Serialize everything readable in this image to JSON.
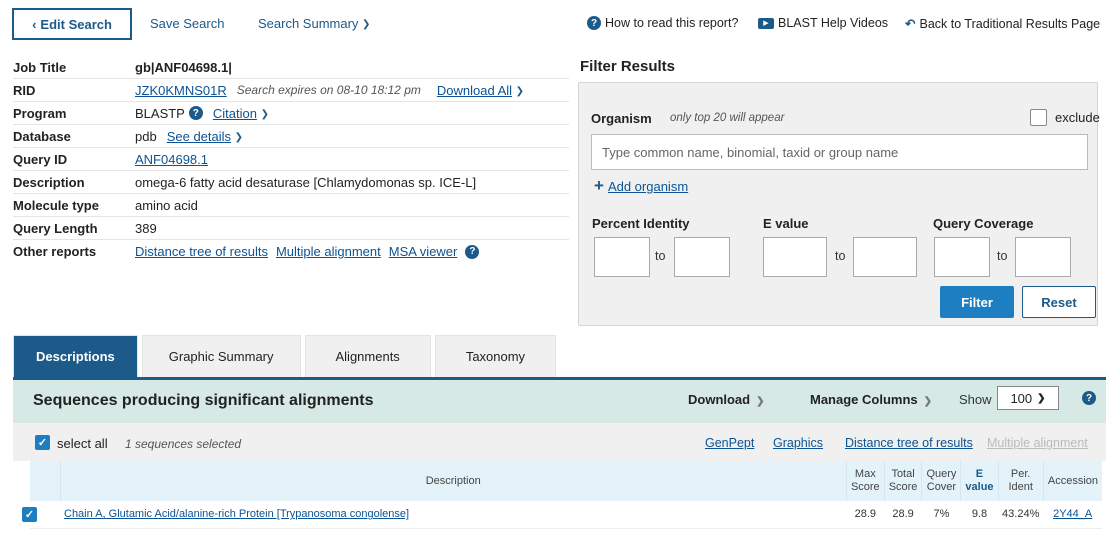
{
  "topbar": {
    "edit_search": "Edit Search",
    "save_search": "Save Search",
    "search_summary": "Search Summary",
    "how_to_read": "How to read this report?",
    "help_videos": "BLAST Help Videos",
    "back_traditional": "Back to Traditional Results Page"
  },
  "info": {
    "job_title_label": "Job Title",
    "job_title": "gb|ANF04698.1|",
    "rid_label": "RID",
    "rid": "JZK0KMNS01R",
    "rid_expires": "Search expires on 08-10 18:12 pm",
    "download_all": "Download All",
    "program_label": "Program",
    "program": "BLASTP",
    "citation": "Citation",
    "database_label": "Database",
    "database": "pdb",
    "see_details": "See details",
    "query_id_label": "Query ID",
    "query_id": "ANF04698.1",
    "description_label": "Description",
    "description": "omega-6 fatty acid desaturase [Chlamydomonas sp. ICE-L]",
    "molecule_type_label": "Molecule type",
    "molecule_type": "amino acid",
    "query_length_label": "Query Length",
    "query_length": "389",
    "other_reports_label": "Other reports",
    "distance_tree": "Distance tree of results",
    "multiple_alignment": "Multiple alignment",
    "msa_viewer": "MSA viewer"
  },
  "filter": {
    "title": "Filter Results",
    "organism_label": "Organism",
    "organism_note": "only top 20 will appear",
    "exclude": "exclude",
    "organism_placeholder": "Type common name, binomial, taxid or group name",
    "add_organism": "Add organism",
    "percent_identity": "Percent Identity",
    "e_value": "E value",
    "query_coverage": "Query Coverage",
    "to": "to",
    "filter_btn": "Filter",
    "reset_btn": "Reset"
  },
  "tabs": [
    "Descriptions",
    "Graphic Summary",
    "Alignments",
    "Taxonomy"
  ],
  "results": {
    "title": "Sequences producing significant alignments",
    "download": "Download",
    "manage_columns": "Manage Columns",
    "show": "Show",
    "show_value": "100",
    "select_all": "select all",
    "selected_note": "1 sequences selected",
    "genpept": "GenPept",
    "graphics": "Graphics",
    "distance_tree": "Distance tree of results",
    "multiple_alignment": "Multiple alignment",
    "columns": {
      "description": "Description",
      "max_score": [
        "Max",
        "Score"
      ],
      "total_score": [
        "Total",
        "Score"
      ],
      "query_cover": [
        "Query",
        "Cover"
      ],
      "e_value": [
        "E",
        "value"
      ],
      "per_ident": [
        "Per.",
        "Ident"
      ],
      "accession": "Accession"
    },
    "rows": [
      {
        "description": "Chain A, Glutamic Acid/alanine-rich Protein [Trypanosoma congolense]",
        "max_score": "28.9",
        "total_score": "28.9",
        "query_cover": "7%",
        "e_value": "9.8",
        "per_ident": "43.24%",
        "accession": "2Y44_A"
      }
    ]
  }
}
